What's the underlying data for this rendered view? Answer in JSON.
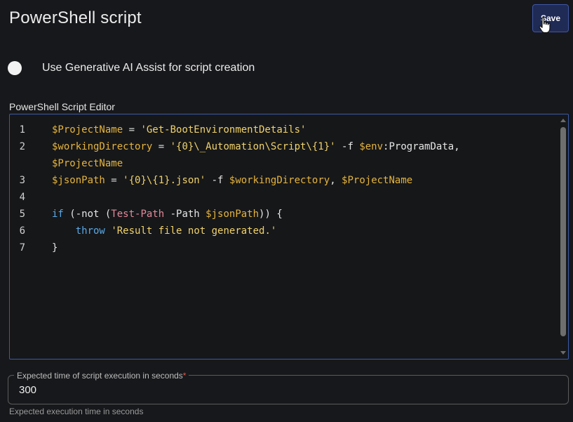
{
  "header": {
    "title": "PowerShell script",
    "save_label": "Save"
  },
  "ai_assist": {
    "label": "Use Generative AI Assist for script creation",
    "enabled": false
  },
  "editor": {
    "label": "PowerShell Script Editor",
    "lines": [
      {
        "num": "1",
        "tokens": [
          {
            "t": "$ProjectName",
            "c": "var"
          },
          {
            "t": " = ",
            "c": "op"
          },
          {
            "t": "'Get-BootEnvironmentDetails'",
            "c": "str"
          }
        ]
      },
      {
        "num": "2",
        "tokens": [
          {
            "t": "$workingDirectory",
            "c": "var"
          },
          {
            "t": " = ",
            "c": "op"
          },
          {
            "t": "'{0}\\_Automation\\Script\\{1}'",
            "c": "str"
          },
          {
            "t": " -f ",
            "c": "plain"
          },
          {
            "t": "$env",
            "c": "var"
          },
          {
            "t": ":ProgramData,",
            "c": "plain"
          }
        ]
      },
      {
        "num": "",
        "tokens": [
          {
            "t": "$ProjectName",
            "c": "var"
          }
        ]
      },
      {
        "num": "3",
        "tokens": [
          {
            "t": "$jsonPath",
            "c": "var"
          },
          {
            "t": " = ",
            "c": "op"
          },
          {
            "t": "'{0}\\{1}.json'",
            "c": "str"
          },
          {
            "t": " -f ",
            "c": "plain"
          },
          {
            "t": "$workingDirectory",
            "c": "var"
          },
          {
            "t": ", ",
            "c": "plain"
          },
          {
            "t": "$ProjectName",
            "c": "var"
          }
        ]
      },
      {
        "num": "4",
        "tokens": []
      },
      {
        "num": "5",
        "tokens": [
          {
            "t": "if",
            "c": "kw"
          },
          {
            "t": " (-not (",
            "c": "plain"
          },
          {
            "t": "Test-Path",
            "c": "cmd"
          },
          {
            "t": " -Path ",
            "c": "plain"
          },
          {
            "t": "$jsonPath",
            "c": "var"
          },
          {
            "t": ")) {",
            "c": "plain"
          }
        ]
      },
      {
        "num": "6",
        "tokens": [
          {
            "t": "    ",
            "c": "plain"
          },
          {
            "t": "throw",
            "c": "kw"
          },
          {
            "t": " ",
            "c": "plain"
          },
          {
            "t": "'Result file not generated.'",
            "c": "str"
          }
        ]
      },
      {
        "num": "7",
        "tokens": [
          {
            "t": "}",
            "c": "plain"
          }
        ]
      }
    ]
  },
  "execution_time": {
    "label": "Expected time of script execution in seconds",
    "required_mark": "*",
    "value": "300",
    "helper": "Expected execution time in seconds"
  },
  "icons": {
    "cursor": "hand-pointer-icon"
  }
}
